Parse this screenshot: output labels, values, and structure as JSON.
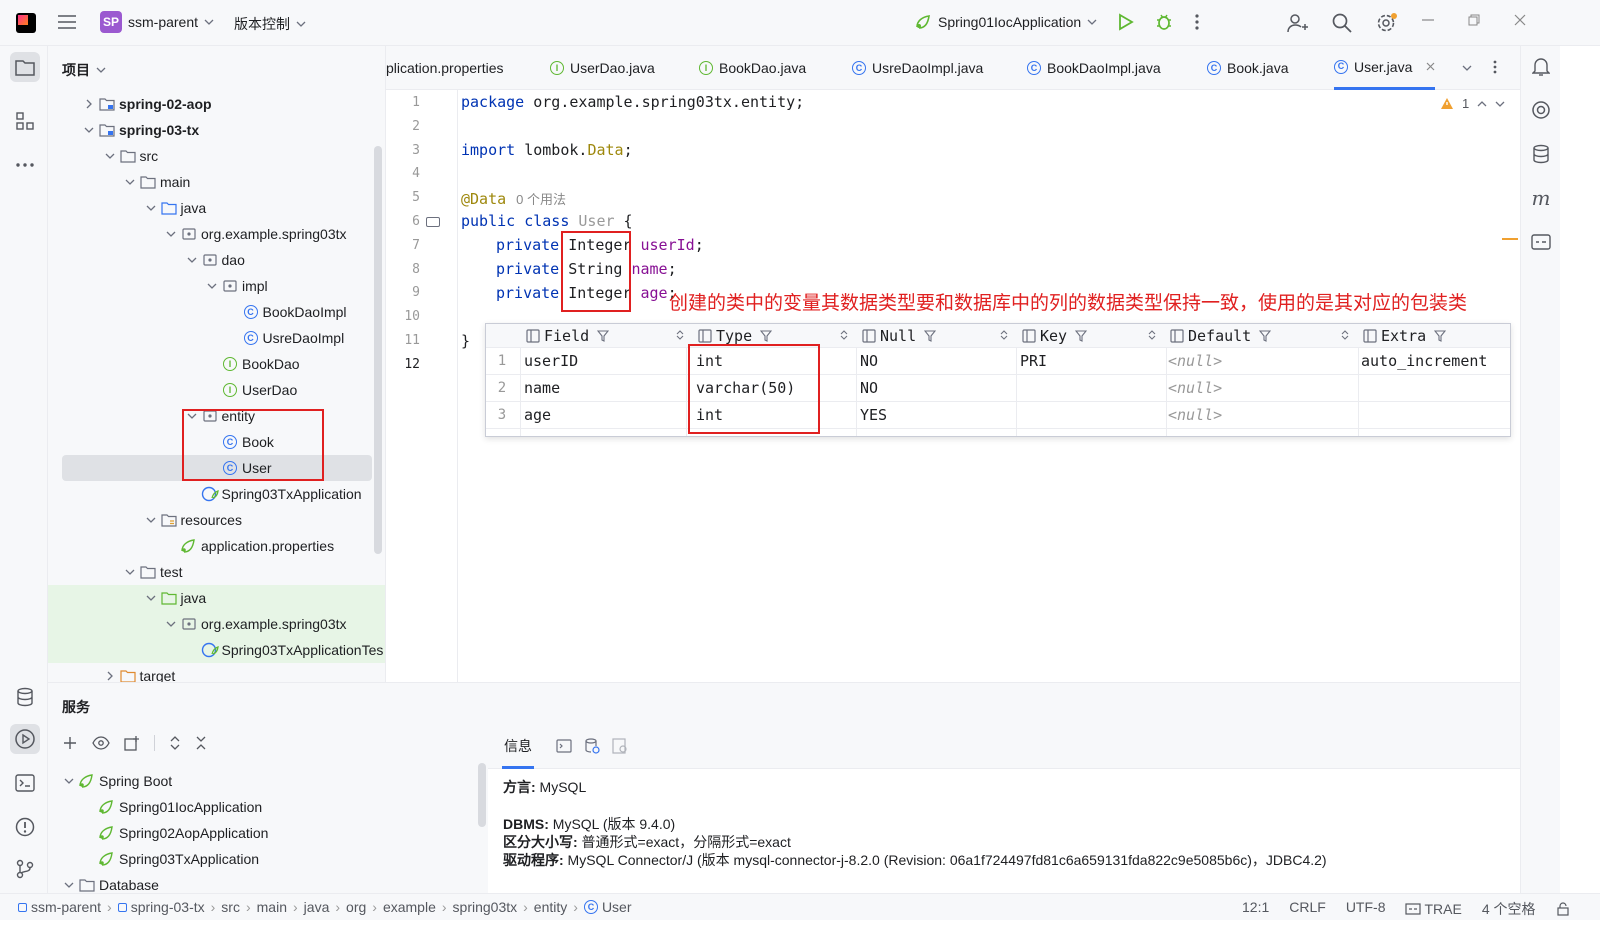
{
  "titlebar": {
    "project_badge": "SP",
    "project_name": "ssm-parent",
    "vcs": "版本控制",
    "run_config": "Spring01IocApplication"
  },
  "project_panel": {
    "title": "项目",
    "tree": [
      {
        "label": "spring-02-aop",
        "depth": 0,
        "expanded": false,
        "icon": "module-folder-icon",
        "bold": true
      },
      {
        "label": "spring-03-tx",
        "depth": 0,
        "expanded": true,
        "icon": "module-folder-icon",
        "bold": true
      },
      {
        "label": "src",
        "depth": 1,
        "expanded": true,
        "icon": "folder-icon"
      },
      {
        "label": "main",
        "depth": 2,
        "expanded": true,
        "icon": "folder-icon"
      },
      {
        "label": "java",
        "depth": 3,
        "expanded": true,
        "icon": "source-folder-icon"
      },
      {
        "label": "org.example.spring03tx",
        "depth": 4,
        "expanded": true,
        "icon": "package-icon"
      },
      {
        "label": "dao",
        "depth": 5,
        "expanded": true,
        "icon": "package-icon"
      },
      {
        "label": "impl",
        "depth": 6,
        "expanded": true,
        "icon": "package-icon"
      },
      {
        "label": "BookDaoImpl",
        "depth": 7,
        "icon": "class-icon"
      },
      {
        "label": "UsreDaoImpl",
        "depth": 7,
        "icon": "class-icon"
      },
      {
        "label": "BookDao",
        "depth": 6,
        "icon": "interface-icon"
      },
      {
        "label": "UserDao",
        "depth": 6,
        "icon": "interface-icon"
      },
      {
        "label": "entity",
        "depth": 5,
        "expanded": true,
        "icon": "package-icon"
      },
      {
        "label": "Book",
        "depth": 6,
        "icon": "class-icon"
      },
      {
        "label": "User",
        "depth": 6,
        "icon": "class-icon",
        "selected": true
      },
      {
        "label": "Spring03TxApplication",
        "depth": 5,
        "icon": "spring-class-icon"
      },
      {
        "label": "resources",
        "depth": 3,
        "expanded": true,
        "icon": "resources-folder-icon"
      },
      {
        "label": "application.properties",
        "depth": 4,
        "icon": "spring-properties-icon"
      },
      {
        "label": "test",
        "depth": 2,
        "expanded": true,
        "icon": "folder-icon"
      },
      {
        "label": "java",
        "depth": 3,
        "expanded": true,
        "icon": "test-folder-icon",
        "test": true
      },
      {
        "label": "org.example.spring03tx",
        "depth": 4,
        "expanded": true,
        "icon": "package-icon",
        "test": true
      },
      {
        "label": "Spring03TxApplicationTes",
        "depth": 5,
        "icon": "spring-class-icon",
        "test": true
      },
      {
        "label": "target",
        "depth": 1,
        "expanded": false,
        "icon": "excluded-folder-icon"
      }
    ]
  },
  "editor_tabs": [
    {
      "label": "plication.properties",
      "kind": "none"
    },
    {
      "label": "UserDao.java",
      "kind": "interface"
    },
    {
      "label": "BookDao.java",
      "kind": "interface"
    },
    {
      "label": "UsreDaoImpl.java",
      "kind": "class"
    },
    {
      "label": "BookDaoImpl.java",
      "kind": "class"
    },
    {
      "label": "Book.java",
      "kind": "class"
    },
    {
      "label": "User.java",
      "kind": "class",
      "active": true
    }
  ],
  "editor": {
    "warning_count": "1",
    "line_numbers": [
      "1",
      "2",
      "3",
      "4",
      "5",
      "6",
      "7",
      "8",
      "9",
      "10",
      "11",
      "12"
    ],
    "code": {
      "l1_kw": "package",
      "l1_rest": " org.example.spring03tx.entity;",
      "l3_kw": "import",
      "l3_pkg": " lombok.",
      "l3_cls": "Data",
      "l3_semi": ";",
      "l5_ann": "@Data",
      "l5_usage": "0 个用法",
      "l6_kw": "public class",
      "l6_name": " User",
      "l6_brace": " {",
      "l7_kw": "private",
      "l7_type": "Integer",
      "l7_field": "userId",
      "l7_semi": ";",
      "l8_kw": "private",
      "l8_type": "String",
      "l8_field": "name",
      "l8_semi": ";",
      "l9_kw": "private",
      "l9_type": "Integer",
      "l9_field": "age",
      "l9_semi": ";",
      "l11": "}"
    },
    "note": "创建的类中的变量其数据类型要和数据库中的列的数据类型保持一致，使用的是其对应的包装类"
  },
  "db_table": {
    "columns": [
      "Field",
      "Type",
      "Null",
      "Key",
      "Default",
      "Extra"
    ],
    "rows": [
      {
        "n": "1",
        "field": "userID",
        "type": "int",
        "null": "NO",
        "key": "PRI",
        "default": "<null>",
        "extra": "auto_increment"
      },
      {
        "n": "2",
        "field": "name",
        "type": "varchar(50)",
        "null": "NO",
        "key": "",
        "default": "<null>",
        "extra": ""
      },
      {
        "n": "3",
        "field": "age",
        "type": "int",
        "null": "YES",
        "key": "",
        "default": "<null>",
        "extra": ""
      }
    ]
  },
  "services": {
    "title": "服务",
    "tree": [
      {
        "label": "Spring Boot",
        "depth": 0,
        "expanded": true,
        "icon": "spring-boot-icon"
      },
      {
        "label": "Spring01IocApplication",
        "depth": 1,
        "icon": "spring-boot-icon"
      },
      {
        "label": "Spring02AopApplication",
        "depth": 1,
        "icon": "spring-boot-icon"
      },
      {
        "label": "Spring03TxApplication",
        "depth": 1,
        "icon": "spring-boot-icon"
      },
      {
        "label": "Database",
        "depth": 0,
        "expanded": true,
        "icon": "folder-icon"
      }
    ],
    "info_tab": "信息",
    "info": {
      "dialect_label": "方言:",
      "dialect_value": " MySQL",
      "dbms_label": "DBMS:",
      "dbms_value": " MySQL (版本 9.4.0)",
      "case_label": "区分大小写:",
      "case_value": " 普通形式=exact，分隔形式=exact",
      "driver_label": "驱动程序:",
      "driver_value": " MySQL Connector/J (版本 mysql-connector-j-8.2.0 (Revision: 06a1f724497fd81c6a659131fda822c9e5085b6c)，JDBC4.2)"
    }
  },
  "statusbar": {
    "crumbs": [
      "ssm-parent",
      "spring-03-tx",
      "src",
      "main",
      "java",
      "org",
      "example",
      "spring03tx",
      "entity",
      "User"
    ],
    "position": "12:1",
    "line_sep": "CRLF",
    "encoding": "UTF-8",
    "ai": "TRAE",
    "indent": "4 个空格"
  },
  "colors": {
    "accent": "#3574f0",
    "annotation_red": "#e02020",
    "keyword": "#0033b3",
    "field": "#871094"
  }
}
